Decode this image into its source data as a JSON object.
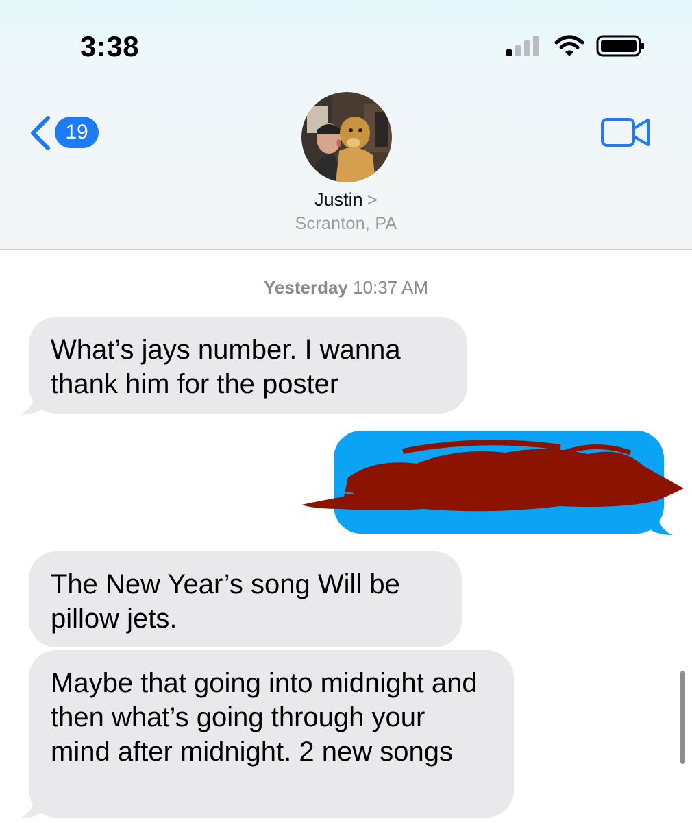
{
  "status_bar": {
    "time": "3:38",
    "signal_icon": "cellular-signal-icon",
    "wifi_icon": "wifi-icon",
    "battery_icon": "battery-icon"
  },
  "nav": {
    "back_icon": "chevron-left-icon",
    "unread_count": "19",
    "video_icon": "video-camera-icon",
    "accent_color": "#1d7bf5"
  },
  "contact": {
    "avatar": "contact-photo-man-with-golden-retriever",
    "name": "Justin",
    "chevron": ">",
    "location": "Scranton, PA"
  },
  "conversation": {
    "timestamp_day": "Yesterday",
    "timestamp_time": "10:37 AM",
    "messages": [
      {
        "direction": "incoming",
        "text": "What’s jays number.  I wanna thank him for the poster"
      },
      {
        "direction": "outgoing",
        "text": "",
        "redacted": true,
        "bubble_color": "#0ba3f3",
        "redaction_color": "#8b1300"
      },
      {
        "direction": "incoming",
        "text": "The New Year’s song Will be pillow jets."
      },
      {
        "direction": "incoming",
        "text": "Maybe that going into midnight and then what’s going through your mind after midnight.  2 new songs"
      }
    ]
  }
}
